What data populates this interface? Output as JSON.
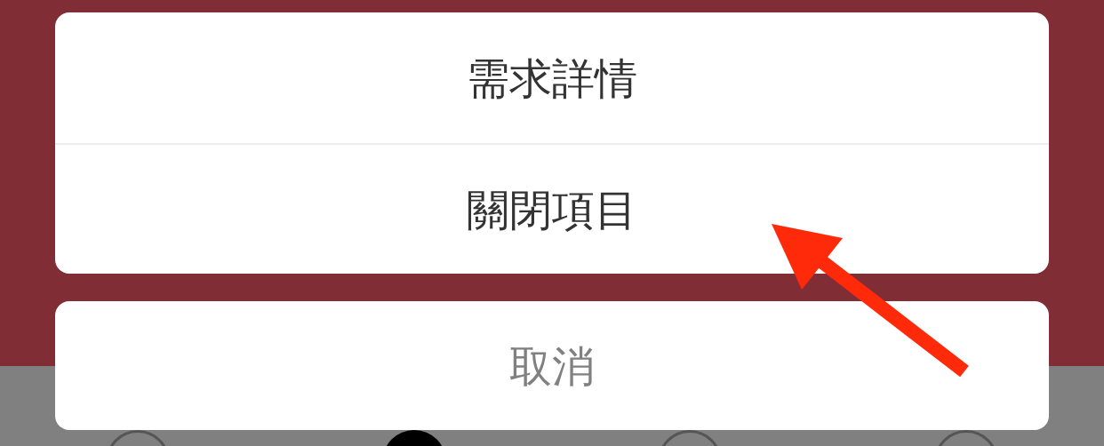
{
  "action_sheet": {
    "options": [
      {
        "label": "需求詳情"
      },
      {
        "label": "關閉項目"
      }
    ],
    "cancel": {
      "label": "取消"
    }
  },
  "tab_bar": {
    "items": [
      {
        "selected": false
      },
      {
        "selected": true
      },
      {
        "selected": false
      },
      {
        "selected": false
      }
    ]
  }
}
